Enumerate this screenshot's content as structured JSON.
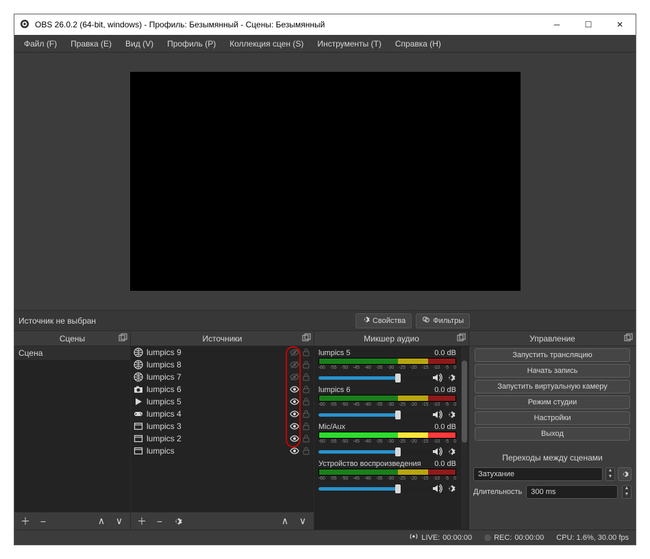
{
  "window": {
    "title": "OBS 26.0.2 (64-bit, windows) - Профиль: Безымянный - Сцены: Безымянный"
  },
  "menu": {
    "file": "Файл (F)",
    "edit": "Правка (E)",
    "view": "Вид (V)",
    "profile": "Профиль (P)",
    "scenecol": "Коллекция сцен (S)",
    "tools": "Инструменты (T)",
    "help": "Справка (H)"
  },
  "midbar": {
    "nosource": "Источник не выбран",
    "properties": "Свойства",
    "filters": "Фильтры"
  },
  "docks": {
    "scenes_title": "Сцены",
    "sources_title": "Источники",
    "mixer_title": "Микшер аудио",
    "controls_title": "Управление",
    "transitions_title": "Переходы между сценами"
  },
  "scenes": {
    "items": [
      {
        "name": "Сцена"
      }
    ]
  },
  "sources": {
    "items": [
      {
        "icon": "globe",
        "name": "lumpics 9",
        "visible": false
      },
      {
        "icon": "globe",
        "name": "lumpics 8",
        "visible": false
      },
      {
        "icon": "globe",
        "name": "lumpics 7",
        "visible": false
      },
      {
        "icon": "camera",
        "name": "lumpics 6",
        "visible": true
      },
      {
        "icon": "play",
        "name": "lumpics 5",
        "visible": true
      },
      {
        "icon": "gamepad",
        "name": "lumpics 4",
        "visible": true
      },
      {
        "icon": "window",
        "name": "lumpics 3",
        "visible": true
      },
      {
        "icon": "window",
        "name": "lumpics 2",
        "visible": true
      },
      {
        "icon": "window",
        "name": "lumpics",
        "visible": true
      }
    ]
  },
  "mixer": {
    "scale": [
      "-60",
      "-55",
      "-50",
      "-45",
      "-40",
      "-35",
      "-30",
      "-25",
      "-20",
      "-15",
      "-10",
      "-5",
      "0"
    ],
    "channels": [
      {
        "name": "lumpics 5",
        "db": "0.0 dB"
      },
      {
        "name": "lumpics 6",
        "db": "0.0 dB"
      },
      {
        "name": "Mic/Aux",
        "db": "0.0 dB",
        "active": true
      },
      {
        "name": "Устройство воспроизведения",
        "db": "0.0 dB"
      }
    ]
  },
  "controls": {
    "stream": "Запустить трансляцию",
    "record": "Начать запись",
    "vcam": "Запустить виртуальную камеру",
    "studio": "Режим студии",
    "settings": "Настройки",
    "exit": "Выход"
  },
  "transitions": {
    "selected": "Затухание",
    "duration_label": "Длительность",
    "duration_value": "300 ms"
  },
  "statusbar": {
    "live_label": "LIVE:",
    "live_time": "00:00:00",
    "rec_label": "REC:",
    "rec_time": "00:00:00",
    "cpu": "CPU: 1.6%, 30.00 fps"
  }
}
